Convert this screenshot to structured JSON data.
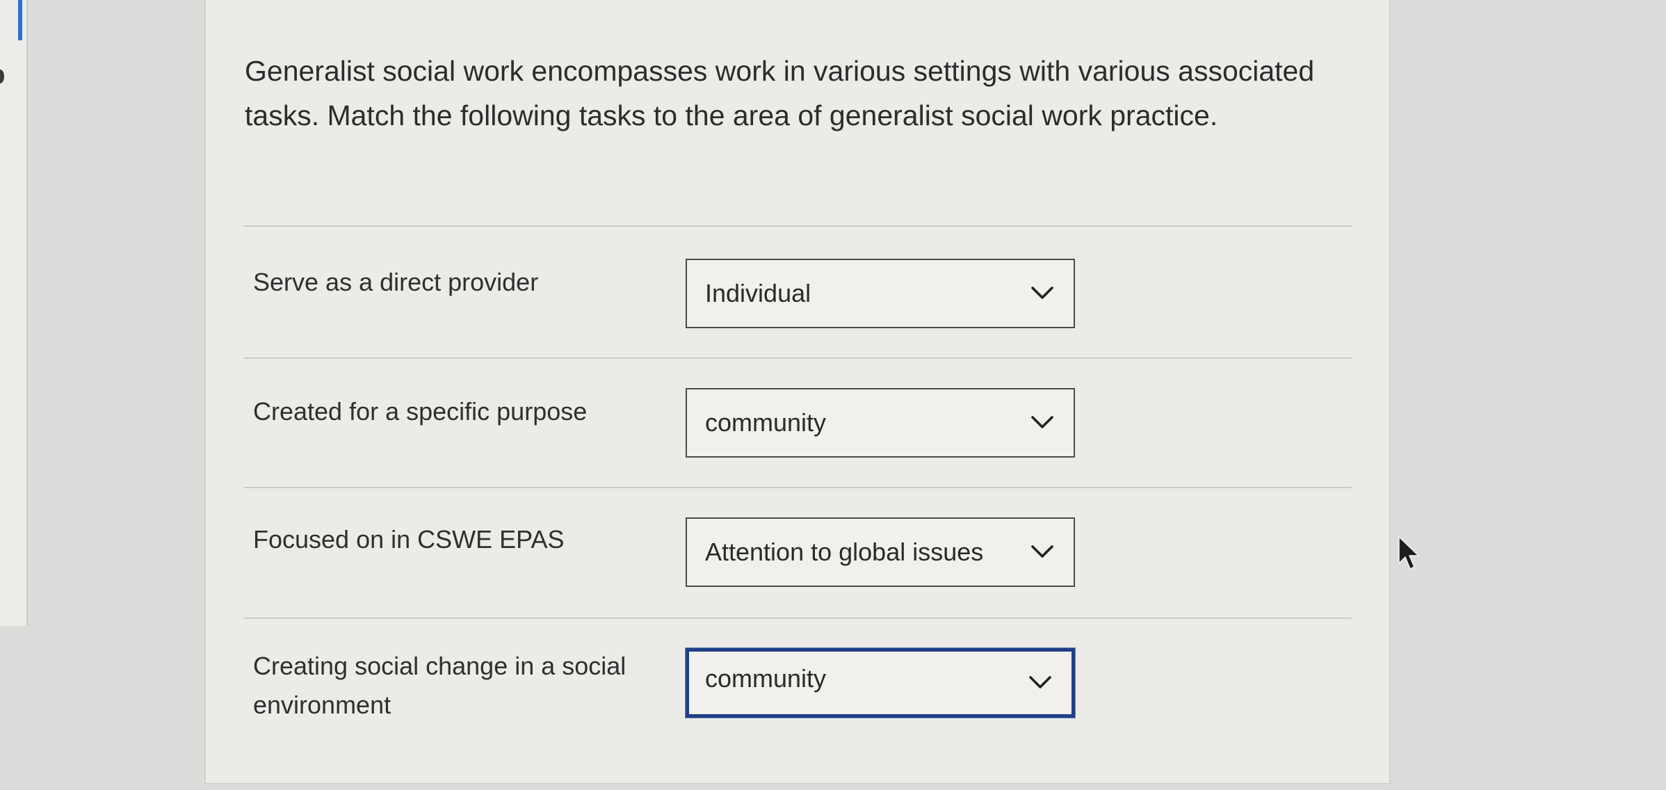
{
  "question": {
    "text": "Generalist social work encompasses work in various settings with various associated tasks. Match the following tasks to the area of generalist social work practice."
  },
  "rows": [
    {
      "label": "Serve as a direct provider",
      "selected": "Individual"
    },
    {
      "label": "Created for a specific purpose",
      "selected": "community"
    },
    {
      "label": "Focused on in CSWE EPAS",
      "selected": "Attention to global issues"
    },
    {
      "label": "Creating social change in a social environment",
      "selected": "community"
    }
  ],
  "icons": {
    "dropdown": "chevron-down-icon",
    "pointer": "mouse-pointer-icon"
  },
  "colors": {
    "page_background": "#dcdcda",
    "card_background": "#ecebe8",
    "focus_border": "#1f3f86",
    "left_accent": "#2f6fd1"
  }
}
